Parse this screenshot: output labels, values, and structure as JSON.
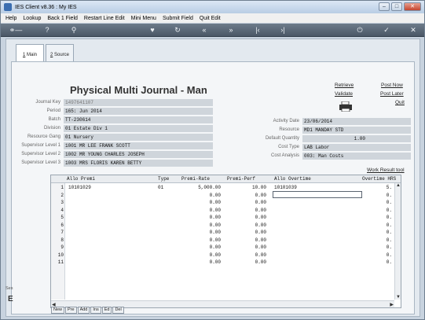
{
  "window": {
    "title": "IES Client v8.36 : My IES"
  },
  "menu": [
    "Help",
    "Lookup",
    "Back 1 Field",
    "Restart Line Edit",
    "Mini Menu",
    "Submit Field",
    "Quit Edit"
  ],
  "toolbar_icons": [
    "key-icon",
    "help-icon",
    "search-icon",
    "heart-icon",
    "refresh-icon",
    "rewind-icon",
    "fast-forward-icon",
    "first-icon",
    "last-icon",
    "power-icon",
    "check-icon",
    "close-icon"
  ],
  "tabs": [
    {
      "num": "1",
      "label": "Main"
    },
    {
      "num": "2",
      "label": "Source"
    }
  ],
  "page_title": "Physical Multi Journal - Man",
  "actions": {
    "retrieve": "Retrieve",
    "post_now": "Post Now",
    "validate": "Validate",
    "post_later": "Post Later",
    "quit": "Quit"
  },
  "left_fields": [
    {
      "label": "Journal Key",
      "value": "1497641107"
    },
    {
      "label": "Period",
      "value": "165: Jun 2014"
    },
    {
      "label": "Batch",
      "value": "TT-230614"
    },
    {
      "label": "Division",
      "value": "01 Estate Div 1"
    },
    {
      "label": "Resource Gang",
      "value": "01 Nursery"
    },
    {
      "label": "Supervisor Level 1",
      "value": "1001 MR LEE FRANK SCOTT"
    },
    {
      "label": "Supervisor Level 2",
      "value": "1002 MR YOUNG CHARLES JOSEPH"
    },
    {
      "label": "Supervisor Level 3",
      "value": "1003 MRS FLORIS KAREN BETTY"
    }
  ],
  "right_fields": [
    {
      "label": "Activity Date",
      "value": "23/06/2014"
    },
    {
      "label": "Resource",
      "value": "MD1 MANDAY STD"
    },
    {
      "label": "Default Quantity",
      "value": "1.00"
    },
    {
      "label": "Cost Type",
      "value": "LAB Labor"
    },
    {
      "label": "Cost Analysis",
      "value": "003: Man Costs"
    }
  ],
  "work_result_tool": "Work Result tool",
  "grid": {
    "headers": [
      "Allo Premi",
      "Type",
      "Premi-Rate",
      "Premi-Perf",
      "Allo Overtime",
      "Overtime HRS"
    ],
    "rows": [
      {
        "n": "1",
        "allo_premi": "10101029",
        "type": "01",
        "rate": "5,000.00",
        "perf": "10.00",
        "allo_ot": "10101039",
        "ot_hrs": "5."
      },
      {
        "n": "2",
        "allo_premi": "",
        "type": "",
        "rate": "0.00",
        "perf": "0.00",
        "allo_ot": "",
        "ot_hrs": "0."
      },
      {
        "n": "3",
        "allo_premi": "",
        "type": "",
        "rate": "0.00",
        "perf": "0.00",
        "allo_ot": "",
        "ot_hrs": "0."
      },
      {
        "n": "4",
        "allo_premi": "",
        "type": "",
        "rate": "0.00",
        "perf": "0.00",
        "allo_ot": "",
        "ot_hrs": "0."
      },
      {
        "n": "5",
        "allo_premi": "",
        "type": "",
        "rate": "0.00",
        "perf": "0.00",
        "allo_ot": "",
        "ot_hrs": "0."
      },
      {
        "n": "6",
        "allo_premi": "",
        "type": "",
        "rate": "0.00",
        "perf": "0.00",
        "allo_ot": "",
        "ot_hrs": "0."
      },
      {
        "n": "7",
        "allo_premi": "",
        "type": "",
        "rate": "0.00",
        "perf": "0.00",
        "allo_ot": "",
        "ot_hrs": "0."
      },
      {
        "n": "8",
        "allo_premi": "",
        "type": "",
        "rate": "0.00",
        "perf": "0.00",
        "allo_ot": "",
        "ot_hrs": "0."
      },
      {
        "n": "9",
        "allo_premi": "",
        "type": "",
        "rate": "0.00",
        "perf": "0.00",
        "allo_ot": "",
        "ot_hrs": "0."
      },
      {
        "n": "10",
        "allo_premi": "",
        "type": "",
        "rate": "0.00",
        "perf": "0.00",
        "allo_ot": "",
        "ot_hrs": "0."
      },
      {
        "n": "11",
        "allo_premi": "",
        "type": "",
        "rate": "0.00",
        "perf": "0.00",
        "allo_ot": "",
        "ot_hrs": "0."
      }
    ]
  },
  "bottom_buttons": [
    "New",
    "Pre",
    "Add",
    "Ins",
    "Ed",
    "Del"
  ],
  "side_label": "Ses",
  "side_letter": "E"
}
